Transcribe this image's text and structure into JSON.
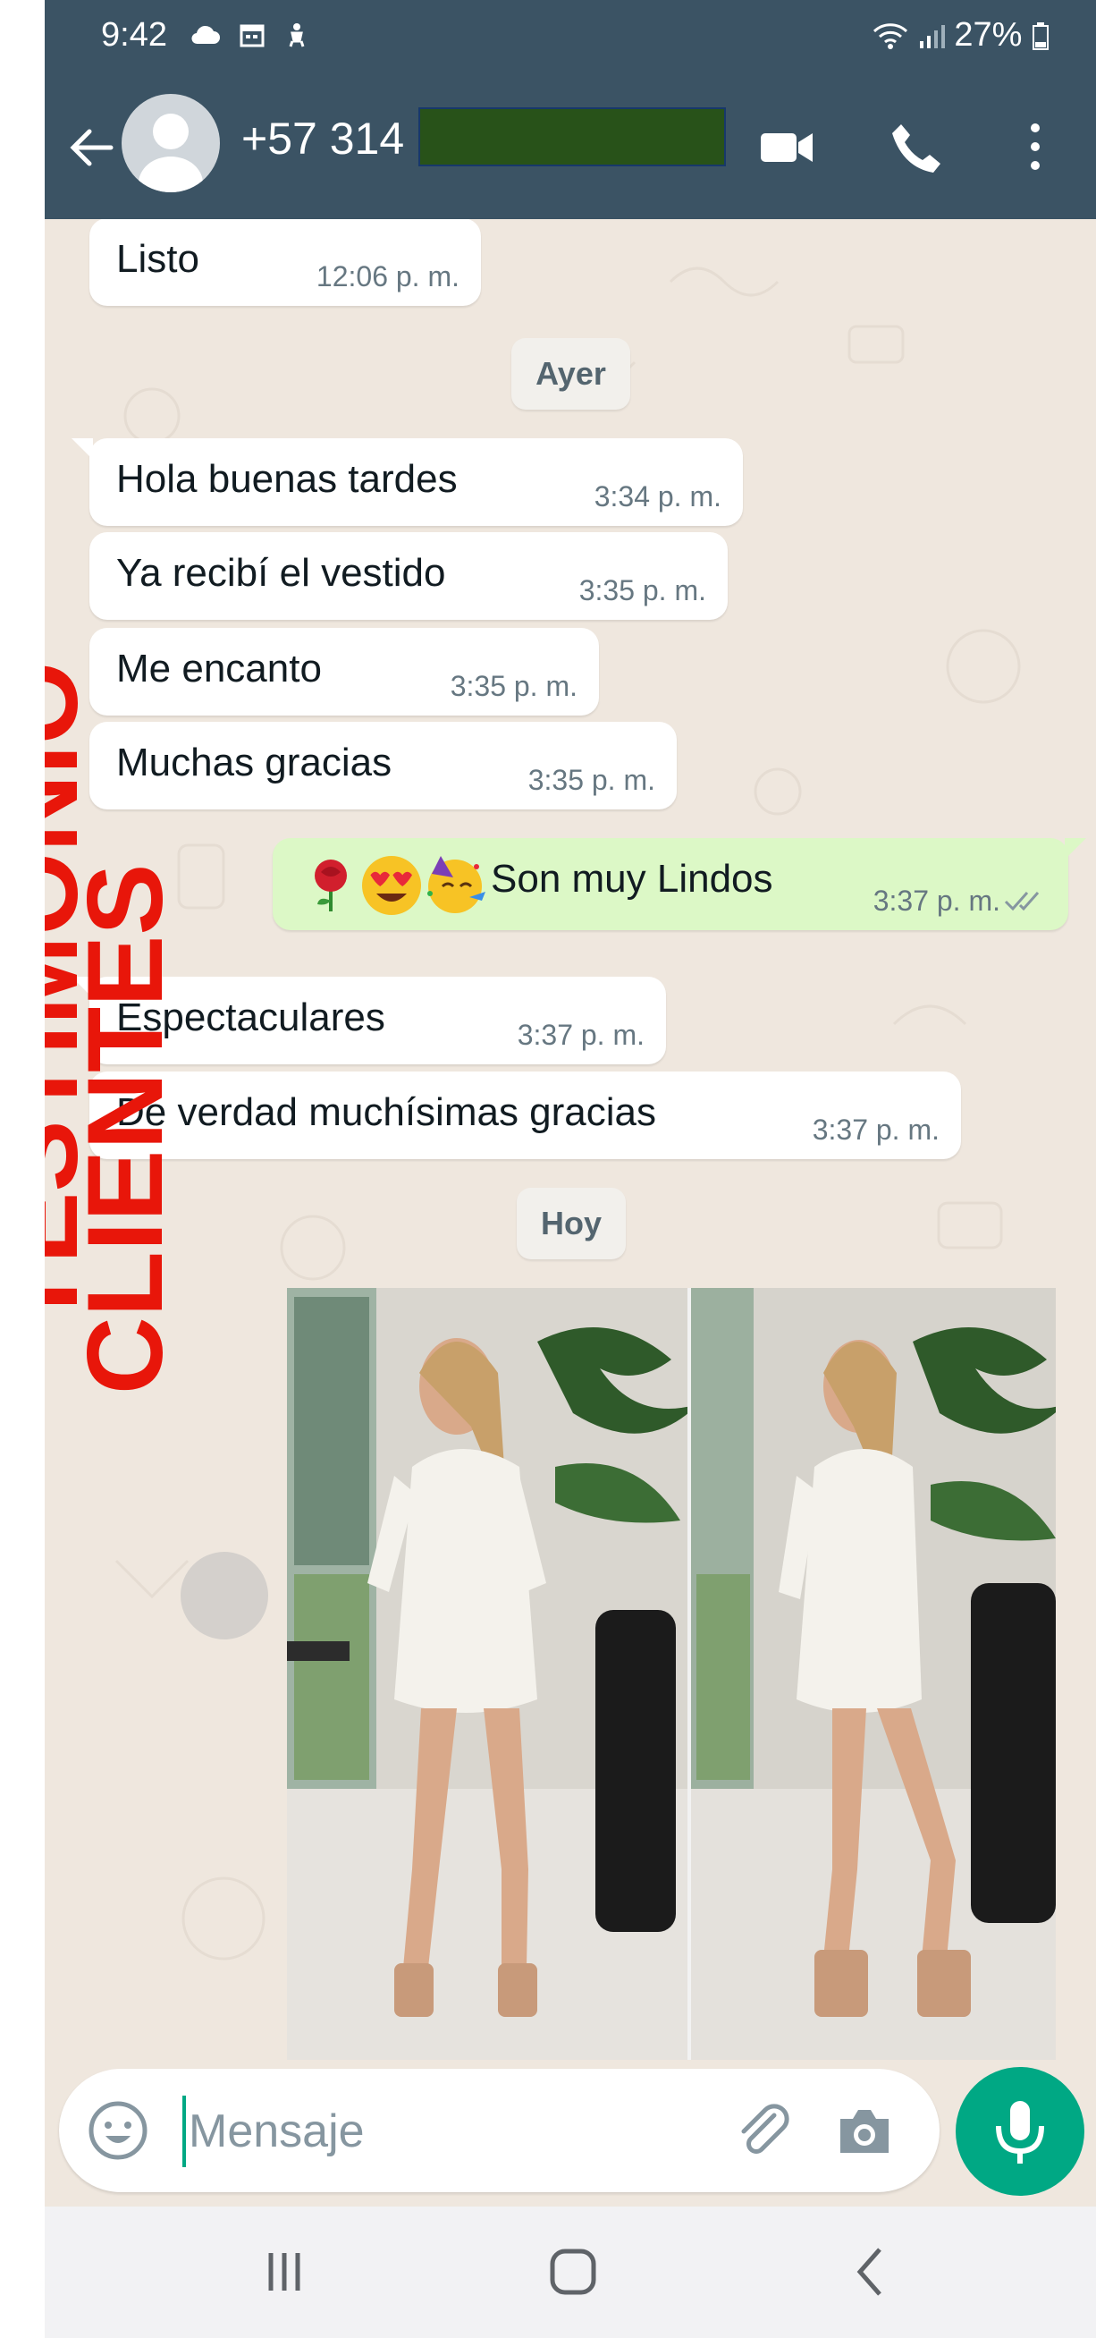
{
  "status_bar": {
    "time": "9:42",
    "battery": "27%"
  },
  "header": {
    "contact_name": "+57 314"
  },
  "messages": [
    {
      "text": "Listo",
      "time": "12:06 p. m."
    },
    {
      "text": "Hola buenas tardes",
      "time": "3:34 p. m."
    },
    {
      "text": "Ya recibí el vestido",
      "time": "3:35 p. m."
    },
    {
      "text": "Me encanto",
      "time": "3:35 p. m."
    },
    {
      "text": "Muchas gracias",
      "time": "3:35 p. m."
    },
    {
      "text": "Son muy Lindos",
      "time": "3:37 p. m."
    },
    {
      "text": "Espectaculares",
      "time": "3:37 p. m."
    },
    {
      "text": "De verdad muchísimas gracias",
      "time": "3:37 p. m."
    }
  ],
  "date_chips": {
    "yesterday": "Ayer",
    "today": "Hoy"
  },
  "overlay": {
    "line1": "TESTIMONIO",
    "line2": "CLIENTES"
  },
  "composer": {
    "placeholder": "Mensaje"
  },
  "icons": {
    "back": "arrow-left-icon",
    "video": "video-call-icon",
    "call": "phone-icon",
    "menu": "more-vert-icon",
    "emoji": "emoji-icon",
    "attach": "paperclip-icon",
    "camera": "camera-icon",
    "mic": "mic-icon",
    "read_receipt": "double-check-icon"
  },
  "colors": {
    "header": "#3b5364",
    "chat_bg": "#efe7de",
    "outgoing_bubble": "#dcf8c6",
    "accent": "#00a884",
    "overlay_red": "#e8160a"
  }
}
